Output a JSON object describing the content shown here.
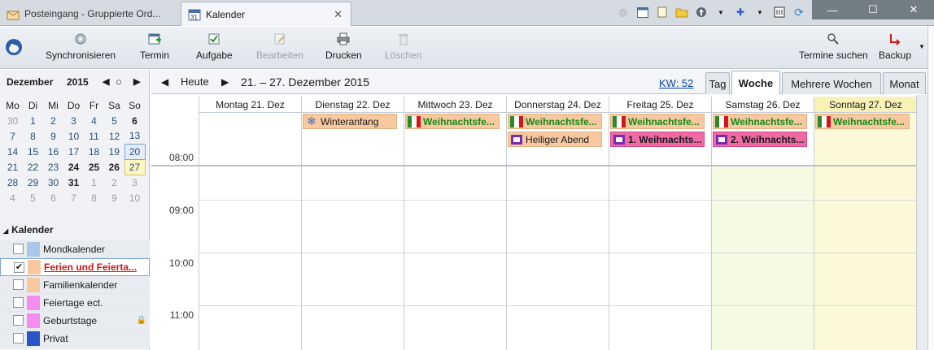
{
  "tabs": [
    {
      "label": "Posteingang - Gruppierte Ord..."
    },
    {
      "label": "Kalender"
    }
  ],
  "toolbar": {
    "sync": "Synchronisieren",
    "termin": "Termin",
    "aufgabe": "Aufgabe",
    "bearbeiten": "Bearbeiten",
    "drucken": "Drucken",
    "loeschen": "Löschen",
    "termine_suchen": "Termine suchen",
    "backup": "Backup"
  },
  "minical": {
    "month": "Dezember",
    "year": "2015",
    "weekdays": [
      "Mo",
      "Di",
      "Mi",
      "Do",
      "Fr",
      "Sa",
      "So"
    ]
  },
  "calendars": {
    "header": "Kalender",
    "items": [
      {
        "name": "Mondkalender",
        "checked": "",
        "color": "#a9c7e8"
      },
      {
        "name": "Ferien und Feierta...",
        "checked": "✔",
        "color": "#f8c9a0"
      },
      {
        "name": "Familienkalender",
        "checked": "",
        "color": "#f8c9a0"
      },
      {
        "name": "Feiertage ect.",
        "checked": "",
        "color": "#f58cf0"
      },
      {
        "name": "Geburtstage",
        "checked": "",
        "color": "#f58cf0"
      },
      {
        "name": "Privat",
        "checked": "",
        "color": "#2a55c8"
      }
    ]
  },
  "nav": {
    "today": "Heute",
    "range": "21. – 27. Dezember 2015",
    "kw": "KW: 52",
    "views": [
      "Tag",
      "Woche",
      "Mehrere Wochen",
      "Monat"
    ]
  },
  "days": [
    "Montag 21. Dez",
    "Dienstag 22. Dez",
    "Mittwoch 23. Dez",
    "Donnerstag 24. Dez",
    "Freitag 25. Dez",
    "Samstag 26. Dez",
    "Sonntag 27. Dez"
  ],
  "hours": [
    "08:00",
    "09:00",
    "10:00",
    "11:00"
  ],
  "events": {
    "winteranfang": "Winteranfang",
    "weihnachtsferien": "Weihnachtsfe...",
    "heiliger_abend": "Heiliger Abend",
    "weihnachtstag1": "1. Weihnachts...",
    "weihnachtstag2": "2. Weihnachts..."
  },
  "colors": {
    "accent_link": "#0645ad",
    "event_orange": "#f8c9a0",
    "event_pink": "#f06aa6",
    "event_green_text": "#138a16",
    "today_column": "#fdf9d8"
  }
}
